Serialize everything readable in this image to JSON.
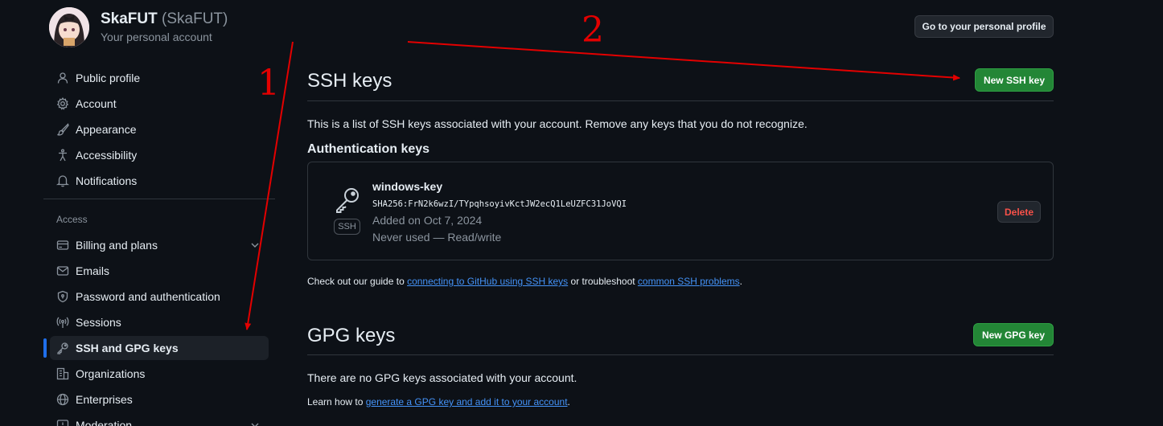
{
  "profile": {
    "name": "SkaFUT",
    "handle": "(SkaFUT)",
    "subtitle": "Your personal account",
    "profile_button": "Go to your personal profile"
  },
  "sidebar": {
    "items": [
      {
        "label": "Public profile",
        "icon": "person-icon"
      },
      {
        "label": "Account",
        "icon": "gear-icon"
      },
      {
        "label": "Appearance",
        "icon": "paintbrush-icon"
      },
      {
        "label": "Accessibility",
        "icon": "accessibility-icon"
      },
      {
        "label": "Notifications",
        "icon": "bell-icon"
      }
    ],
    "access_heading": "Access",
    "access_items": [
      {
        "label": "Billing and plans",
        "icon": "credit-card-icon"
      },
      {
        "label": "Emails",
        "icon": "mail-icon"
      },
      {
        "label": "Password and authentication",
        "icon": "shield-lock-icon"
      },
      {
        "label": "Sessions",
        "icon": "broadcast-icon"
      },
      {
        "label": "SSH and GPG keys",
        "icon": "key-icon"
      },
      {
        "label": "Organizations",
        "icon": "organization-icon"
      },
      {
        "label": "Enterprises",
        "icon": "globe-icon"
      },
      {
        "label": "Moderation",
        "icon": "report-icon"
      }
    ]
  },
  "ssh": {
    "title": "SSH keys",
    "new_button": "New SSH key",
    "description": "This is a list of SSH keys associated with your account. Remove any keys that you do not recognize.",
    "auth_heading": "Authentication keys",
    "key": {
      "name": "windows-key",
      "fingerprint": "SHA256:FrN2k6wzI/TYpqhsoyivKctJW2ecQ1LeUZFC31JoVQI",
      "added": "Added on Oct 7, 2024",
      "usage": "Never used — Read/write",
      "badge": "SSH",
      "delete_button": "Delete"
    },
    "guide_prefix": "Check out our guide to ",
    "guide_link1": "connecting to GitHub using SSH keys",
    "guide_middle": " or troubleshoot ",
    "guide_link2": "common SSH problems",
    "guide_suffix": "."
  },
  "gpg": {
    "title": "GPG keys",
    "new_button": "New GPG key",
    "empty": "There are no GPG keys associated with your account.",
    "learn_prefix": "Learn how to ",
    "learn_link": "generate a GPG key and add it to your account",
    "learn_suffix": "."
  },
  "annotations": {
    "one": "1",
    "two": "2",
    "color": "#e30000"
  },
  "colors": {
    "background": "#0d1117",
    "accent": "#1f6feb",
    "green": "#238636",
    "danger": "#f85149",
    "link": "#4493f8"
  }
}
